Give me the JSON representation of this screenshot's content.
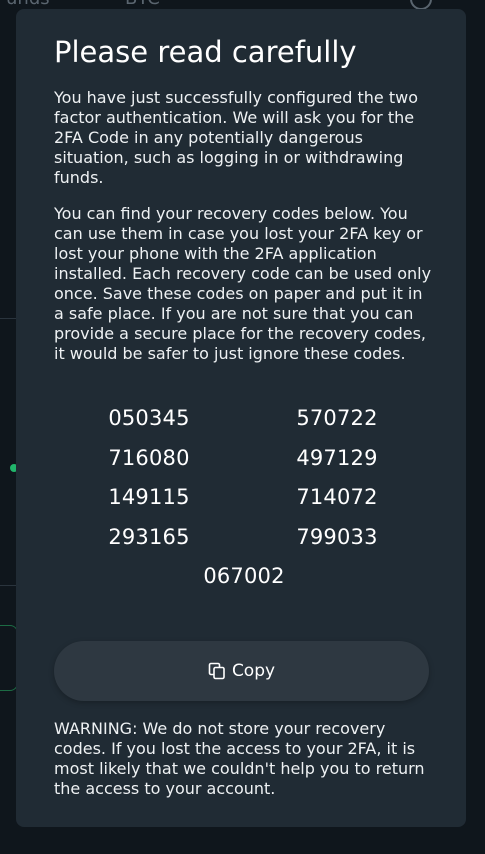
{
  "background": {
    "top_left_text": "unds",
    "top_mid_text": "BTC"
  },
  "modal": {
    "title": "Please read carefully",
    "paragraph1": "You have just successfully configured the two factor authentication. We will ask you for the 2FA Code in any potentially dangerous situation, such as logging in or withdrawing funds.",
    "paragraph2": "You can find your recovery codes below. You can use them in case you lost your 2FA key or lost your phone with the 2FA application installed. Each recovery code can be used only once. Save these codes on paper and put it in a safe place. If you are not sure that you can provide a secure place for the recovery codes, it would be safer to just ignore these codes.",
    "codes": [
      "050345",
      "570722",
      "716080",
      "497129",
      "149115",
      "714072",
      "293165",
      "799033",
      "067002"
    ],
    "copy_label": "Copy",
    "warning": "WARNING: We do not store your recovery codes. If you lost the access to your 2FA, it is most likely that we couldn't help you to return the access to your account."
  },
  "colors": {
    "modal_bg": "#202b34",
    "button_bg": "#2e3841",
    "accent_green": "#21b56b"
  }
}
